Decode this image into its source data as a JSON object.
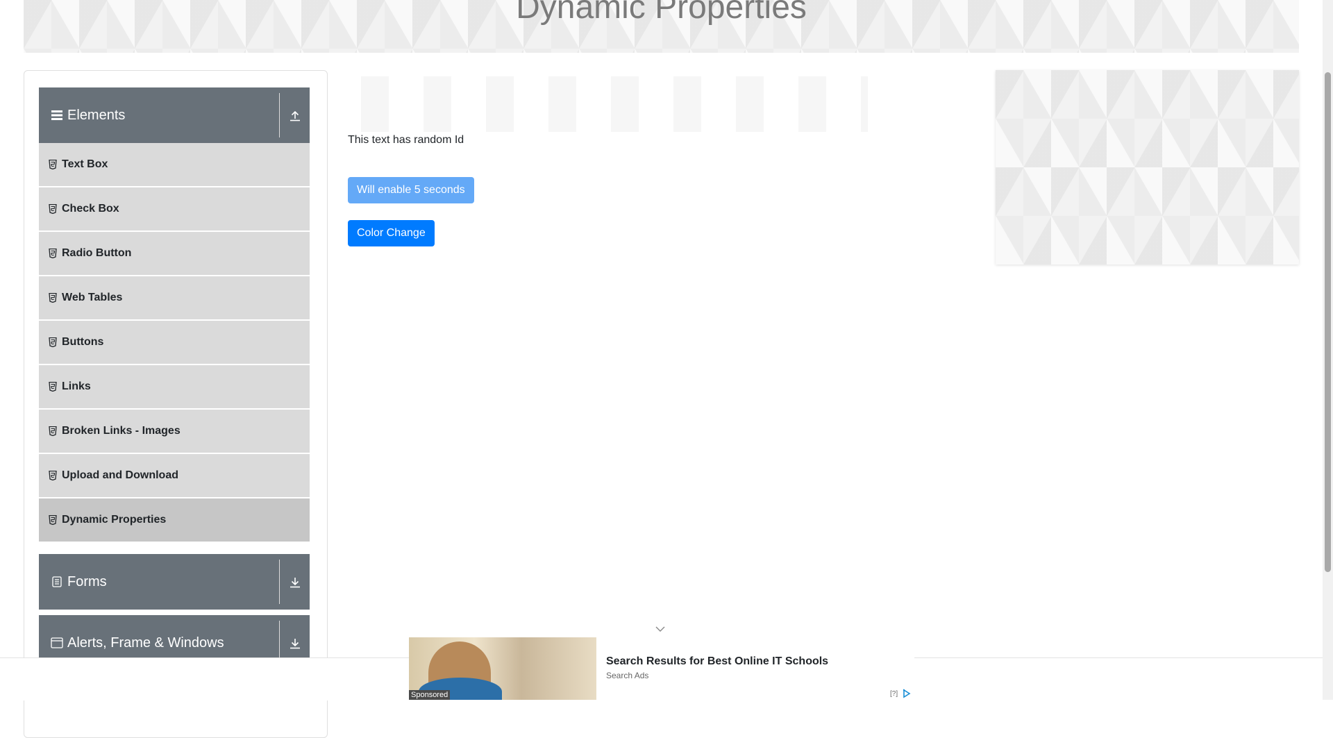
{
  "banner": {
    "title": "Dynamic Properties"
  },
  "sidebar": {
    "elements_group": {
      "title": "Elements",
      "icon": "bars-icon",
      "toggle_icon": "upload-icon"
    },
    "items": [
      {
        "label": "Text Box",
        "active": false
      },
      {
        "label": "Check Box",
        "active": false
      },
      {
        "label": "Radio Button",
        "active": false
      },
      {
        "label": "Web Tables",
        "active": false
      },
      {
        "label": "Buttons",
        "active": false
      },
      {
        "label": "Links",
        "active": false
      },
      {
        "label": "Broken Links - Images",
        "active": false
      },
      {
        "label": "Upload and Download",
        "active": false
      },
      {
        "label": "Dynamic Properties",
        "active": true
      }
    ],
    "forms_group": {
      "title": "Forms",
      "icon": "document-icon",
      "toggle_icon": "download-icon"
    },
    "alerts_group": {
      "title": "Alerts, Frame & Windows",
      "icon": "window-icon",
      "toggle_icon": "download-icon"
    }
  },
  "main": {
    "random_id_text": "This text has random Id",
    "enable_button_label": "Will enable 5 seconds",
    "color_change_button_label": "Color Change"
  },
  "ad": {
    "title": "Search Results for Best Online IT Schools",
    "subtitle": "Search Ads",
    "sponsored_label": "Sponsored",
    "help_label": "[?]"
  },
  "colors": {
    "group_header": "#687179",
    "menu_item": "#dadada",
    "menu_item_active": "#c6c6c6",
    "primary_button": "#007bff",
    "disabled_button": "#64a9f7"
  }
}
